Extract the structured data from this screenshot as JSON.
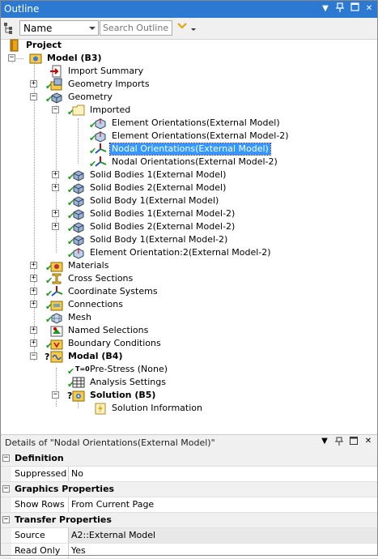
{
  "window": {
    "title": "Outline"
  },
  "toolbar": {
    "filter_value": "Name",
    "search_placeholder": "Search Outline"
  },
  "tree": {
    "project": "Project",
    "model": "Model (B3)",
    "import_summary": "Import Summary",
    "geometry_imports": "Geometry Imports",
    "geometry": "Geometry",
    "imported": "Imported",
    "items": [
      "Element Orientations(External Model)",
      "Element Orientations(External Model-2)",
      "Nodal Orientations(External Model)",
      "Nodal Orientations(External Model-2)"
    ],
    "bodies": [
      "Solid Bodies 1(External Model)",
      "Solid Bodies 2(External Model)",
      "Solid Body 1(External Model)",
      "Solid Bodies 1(External Model-2)",
      "Solid Bodies 2(External Model-2)",
      "Solid Body 1(External Model-2)",
      "Element Orientation:2(External Model-2)"
    ],
    "materials": "Materials",
    "cross_sections": "Cross Sections",
    "coordinate_systems": "Coordinate Systems",
    "connections": "Connections",
    "mesh": "Mesh",
    "named_selections": "Named Selections",
    "boundary_conditions": "Boundary Conditions",
    "modal": "Modal (B4)",
    "pre_stress": "Pre-Stress (None)",
    "analysis_settings": "Analysis Settings",
    "solution": "Solution (B5)",
    "solution_information": "Solution Information",
    "prestress_badge": "T=0"
  },
  "details": {
    "title": "Details of \"Nodal Orientations(External Model)\"",
    "groups": [
      {
        "name": "Definition",
        "rows": [
          {
            "key": "Suppressed",
            "value": "No"
          }
        ]
      },
      {
        "name": "Graphics Properties",
        "rows": [
          {
            "key": "Show Rows",
            "value": "From Current Page"
          }
        ]
      },
      {
        "name": "Transfer Properties",
        "rows": [
          {
            "key": "Source",
            "value": "A2::External Model"
          },
          {
            "key": "Read Only",
            "value": "Yes"
          }
        ]
      }
    ]
  },
  "colors": {
    "titlebar": "#2b79d0",
    "selection": "#3399ff",
    "check": "#1a9a1a"
  }
}
